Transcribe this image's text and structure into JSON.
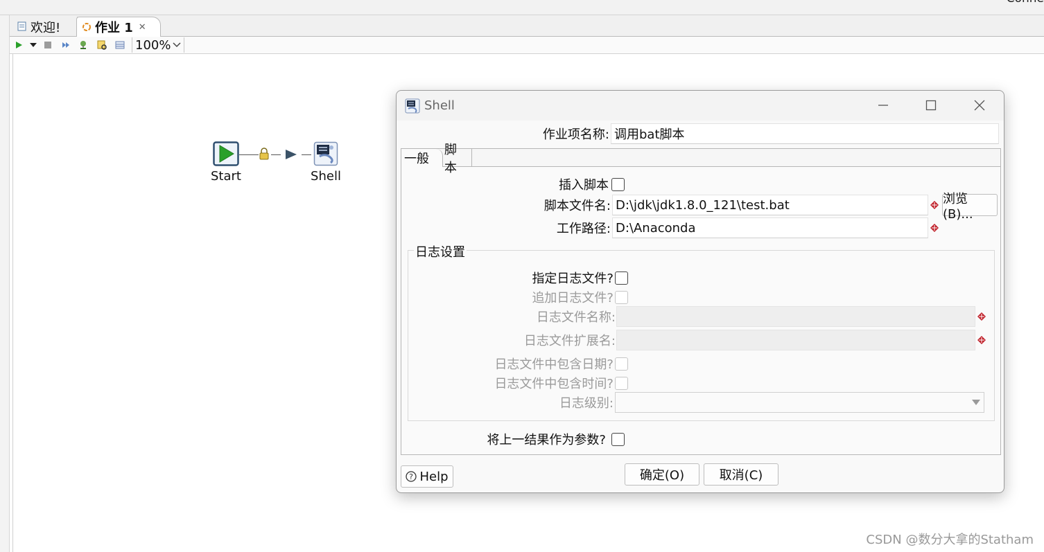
{
  "top": {
    "right_text": "Conne"
  },
  "tabs": [
    {
      "label": "欢迎!"
    },
    {
      "label": "作业 1",
      "close": "✕"
    }
  ],
  "toolbar": {
    "zoom_value": "100%"
  },
  "canvas": {
    "nodes": [
      {
        "label": "Start"
      },
      {
        "label": "Shell"
      }
    ]
  },
  "dialog": {
    "title": "Shell",
    "entry_name_label": "作业项名称:",
    "entry_name_value": "调用bat脚本",
    "tabs": [
      "一般",
      "脚本"
    ],
    "insert_script_label": "插入脚本",
    "script_file_label": "脚本文件名:",
    "script_file_value": "D:\\jdk\\jdk1.8.0_121\\test.bat",
    "browse_button": "浏览(B)...",
    "work_dir_label": "工作路径:",
    "work_dir_value": "D:\\Anaconda",
    "log_group_title": "日志设置",
    "specify_log_label": "指定日志文件?",
    "append_log_label": "追加日志文件?",
    "log_filename_label": "日志文件名称:",
    "log_ext_label": "日志文件扩展名:",
    "log_include_date_label": "日志文件中包含日期?",
    "log_include_time_label": "日志文件中包含时间?",
    "log_level_label": "日志级别:",
    "prev_result_label": "将上一结果作为参数?",
    "help_button": "Help",
    "ok_button": "确定(O)",
    "cancel_button": "取消(C)"
  },
  "watermark": "CSDN @数分大拿的Statham",
  "colors": {
    "accent_green": "#2aa02a",
    "required_marker": "#c0202a",
    "hop_arrow": "#3b5368"
  }
}
